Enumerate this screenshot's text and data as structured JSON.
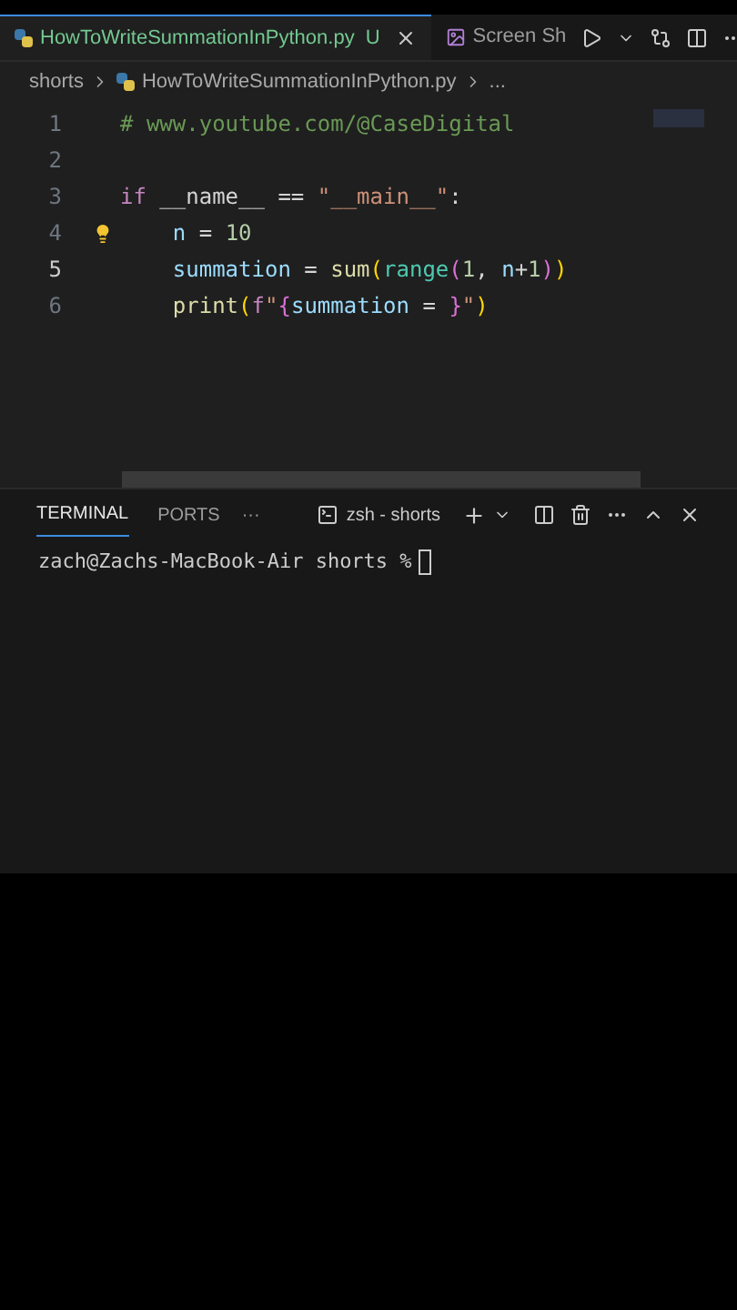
{
  "tabs": [
    {
      "label": "HowToWriteSummationInPython.py",
      "badge": "U",
      "kind": "python",
      "selected": true
    },
    {
      "label": "Screen Sh",
      "kind": "image",
      "selected": false
    }
  ],
  "breadcrumb": [
    "shorts",
    "HowToWriteSummationInPython.py",
    "..."
  ],
  "code_lines": [
    {
      "number": "1",
      "active": false,
      "tokens": [
        {
          "kind": "comment",
          "text": "# www.youtube.com/@CaseDigital"
        }
      ]
    },
    {
      "number": "2",
      "active": false
    },
    {
      "number": "3",
      "active": false,
      "tokens": [
        {
          "kind": "keyword",
          "text": "if"
        },
        {
          "kind": "plain",
          "text": " __name__ == "
        },
        {
          "kind": "string",
          "text": "\"__main__\""
        },
        {
          "kind": "plain",
          "text": ":"
        }
      ]
    },
    {
      "number": "4",
      "active": false,
      "lightbulb": true,
      "tokens": [
        {
          "kind": "variable",
          "text": "    n"
        },
        {
          "kind": "plain",
          "text": " = "
        },
        {
          "kind": "number",
          "text": "10"
        }
      ]
    },
    {
      "number": "5",
      "active": true,
      "tokens": [
        {
          "kind": "variable",
          "text": "    summation"
        },
        {
          "kind": "plain",
          "text": " = "
        },
        {
          "kind": "function",
          "text": "sum"
        },
        {
          "kind": "bracket",
          "text": "("
        },
        {
          "kind": "builtin",
          "text": "range"
        },
        {
          "kind": "bracket2",
          "text": "("
        },
        {
          "kind": "number",
          "text": "1"
        },
        {
          "kind": "plain",
          "text": ", "
        },
        {
          "kind": "variable",
          "text": "n"
        },
        {
          "kind": "plain",
          "text": "+"
        },
        {
          "kind": "number",
          "text": "1"
        },
        {
          "kind": "bracket2",
          "text": ")"
        },
        {
          "kind": "bracket",
          "text": ")"
        }
      ]
    },
    {
      "number": "6",
      "active": false,
      "tokens": [
        {
          "kind": "function",
          "text": "    print"
        },
        {
          "kind": "bracket",
          "text": "("
        },
        {
          "kind": "keyword",
          "text": "f"
        },
        {
          "kind": "string",
          "text": "\""
        },
        {
          "kind": "bracket2",
          "text": "{"
        },
        {
          "kind": "variable",
          "text": "summation"
        },
        {
          "kind": "plain",
          "text": " = "
        },
        {
          "kind": "bracket2",
          "text": "}"
        },
        {
          "kind": "string",
          "text": "\""
        },
        {
          "kind": "bracket",
          "text": ")"
        }
      ]
    }
  ],
  "panel": {
    "tabs": [
      {
        "label": "TERMINAL",
        "selected": true
      },
      {
        "label": "PORTS",
        "selected": false
      }
    ],
    "more": "···",
    "terminal_name": "zsh - shorts",
    "prompt": "zach@Zachs-MacBook-Air shorts %"
  }
}
